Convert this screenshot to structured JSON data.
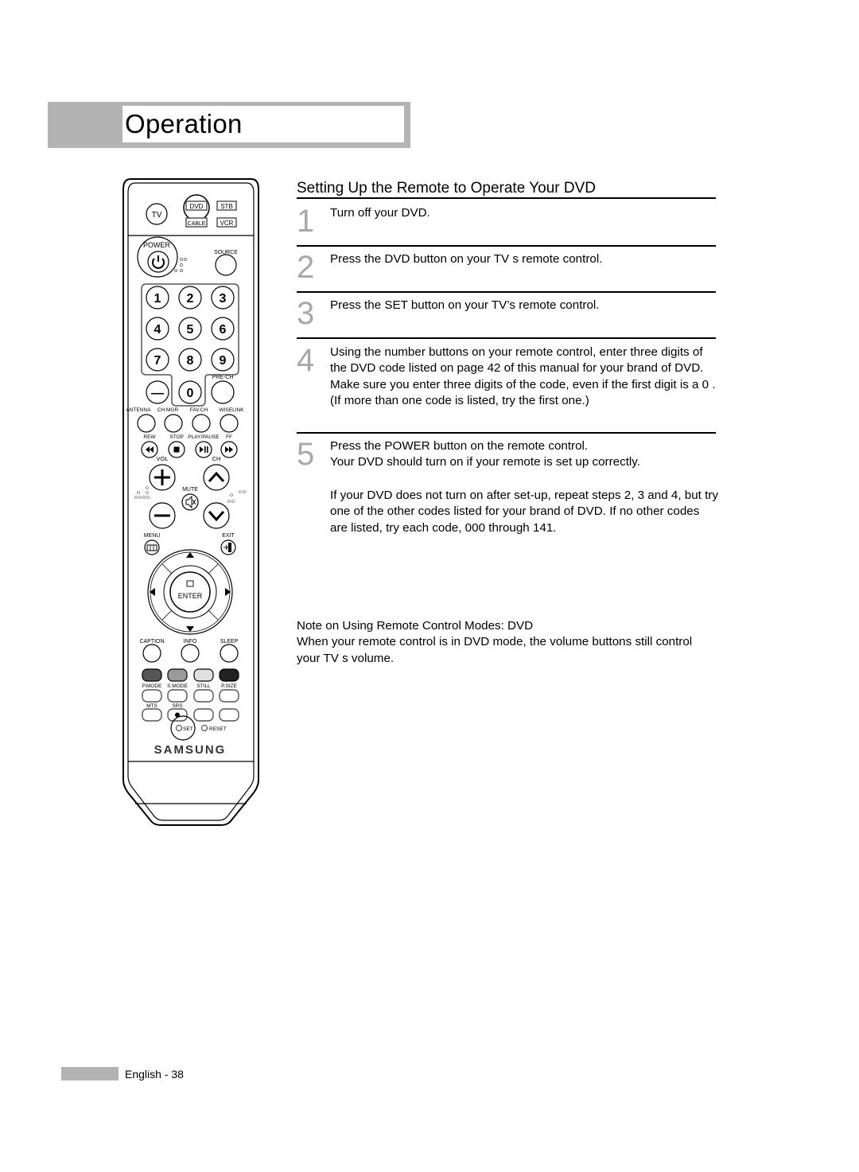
{
  "header": {
    "title": "Operation"
  },
  "section": {
    "title": "Setting Up the Remote to Operate Your DVD",
    "steps": [
      {
        "number": "1",
        "text": "Turn off your DVD."
      },
      {
        "number": "2",
        "text": "Press the DVD button on your TV s remote control."
      },
      {
        "number": "3",
        "text": "Press the SET button on your TV’s remote control."
      },
      {
        "number": "4",
        "text": "Using the number buttons on your remote control, enter three digits of the DVD code listed on page 42 of this manual for your brand of DVD. Make sure you enter three digits of the code, even if the first digit is a  0 . (If more than one code is listed, try the first one.)"
      },
      {
        "number": "5",
        "text": "Press the POWER button on the remote control. Your DVD should turn on if your remote is set up correctly."
      }
    ],
    "step5_line1": "Press the POWER button on the remote control.",
    "step5_line2": "Your DVD should turn on if your remote is set up correctly.",
    "extra_paragraph": "If your DVD does not turn on after set-up, repeat steps 2, 3 and 4, but try one of the other codes listed for your brand of DVD. If no other codes are listed, try each code, 000 through 141."
  },
  "note": {
    "title": "Note on Using Remote Control Modes: DVD",
    "text": "When your remote control is in  DVD  mode, the volume buttons still control your TV s volume."
  },
  "remote": {
    "mode_buttons": {
      "tv": "TV",
      "dvd": "DVD",
      "stb": "STB",
      "cable": "CABLE",
      "vcr": "VCR"
    },
    "power_label": "POWER",
    "source_label": "SOURCE",
    "digits": [
      "1",
      "2",
      "3",
      "4",
      "5",
      "6",
      "7",
      "8",
      "9",
      "0"
    ],
    "dash_label": "—",
    "prech_label": "PRE-CH",
    "function_labels": [
      "ANTENNA",
      "CH MGR",
      "FAV.CH",
      "WISELINK"
    ],
    "transport_labels": [
      "REW",
      "STOP",
      "PLAY/PAUSE",
      "FF"
    ],
    "vol_label": "VOL",
    "ch_label": "CH",
    "mute_label": "MUTE",
    "menu_label": "MENU",
    "exit_label": "EXIT",
    "enter_label": "ENTER",
    "info_labels": [
      "CAPTION",
      "INFO",
      "SLEEP"
    ],
    "color_button_fills": [
      "#555555",
      "#9a9a9a",
      "#e0e0e0",
      "#222222"
    ],
    "mode_labels": [
      "P.MODE",
      "S.MODE",
      "STILL",
      "P.SIZE"
    ],
    "audio_labels": [
      "MTS",
      "SRS"
    ],
    "set_label": "SET",
    "reset_label": "RESET",
    "brand": "SAMSUNG"
  },
  "footer": {
    "page_label": "English - 38"
  }
}
